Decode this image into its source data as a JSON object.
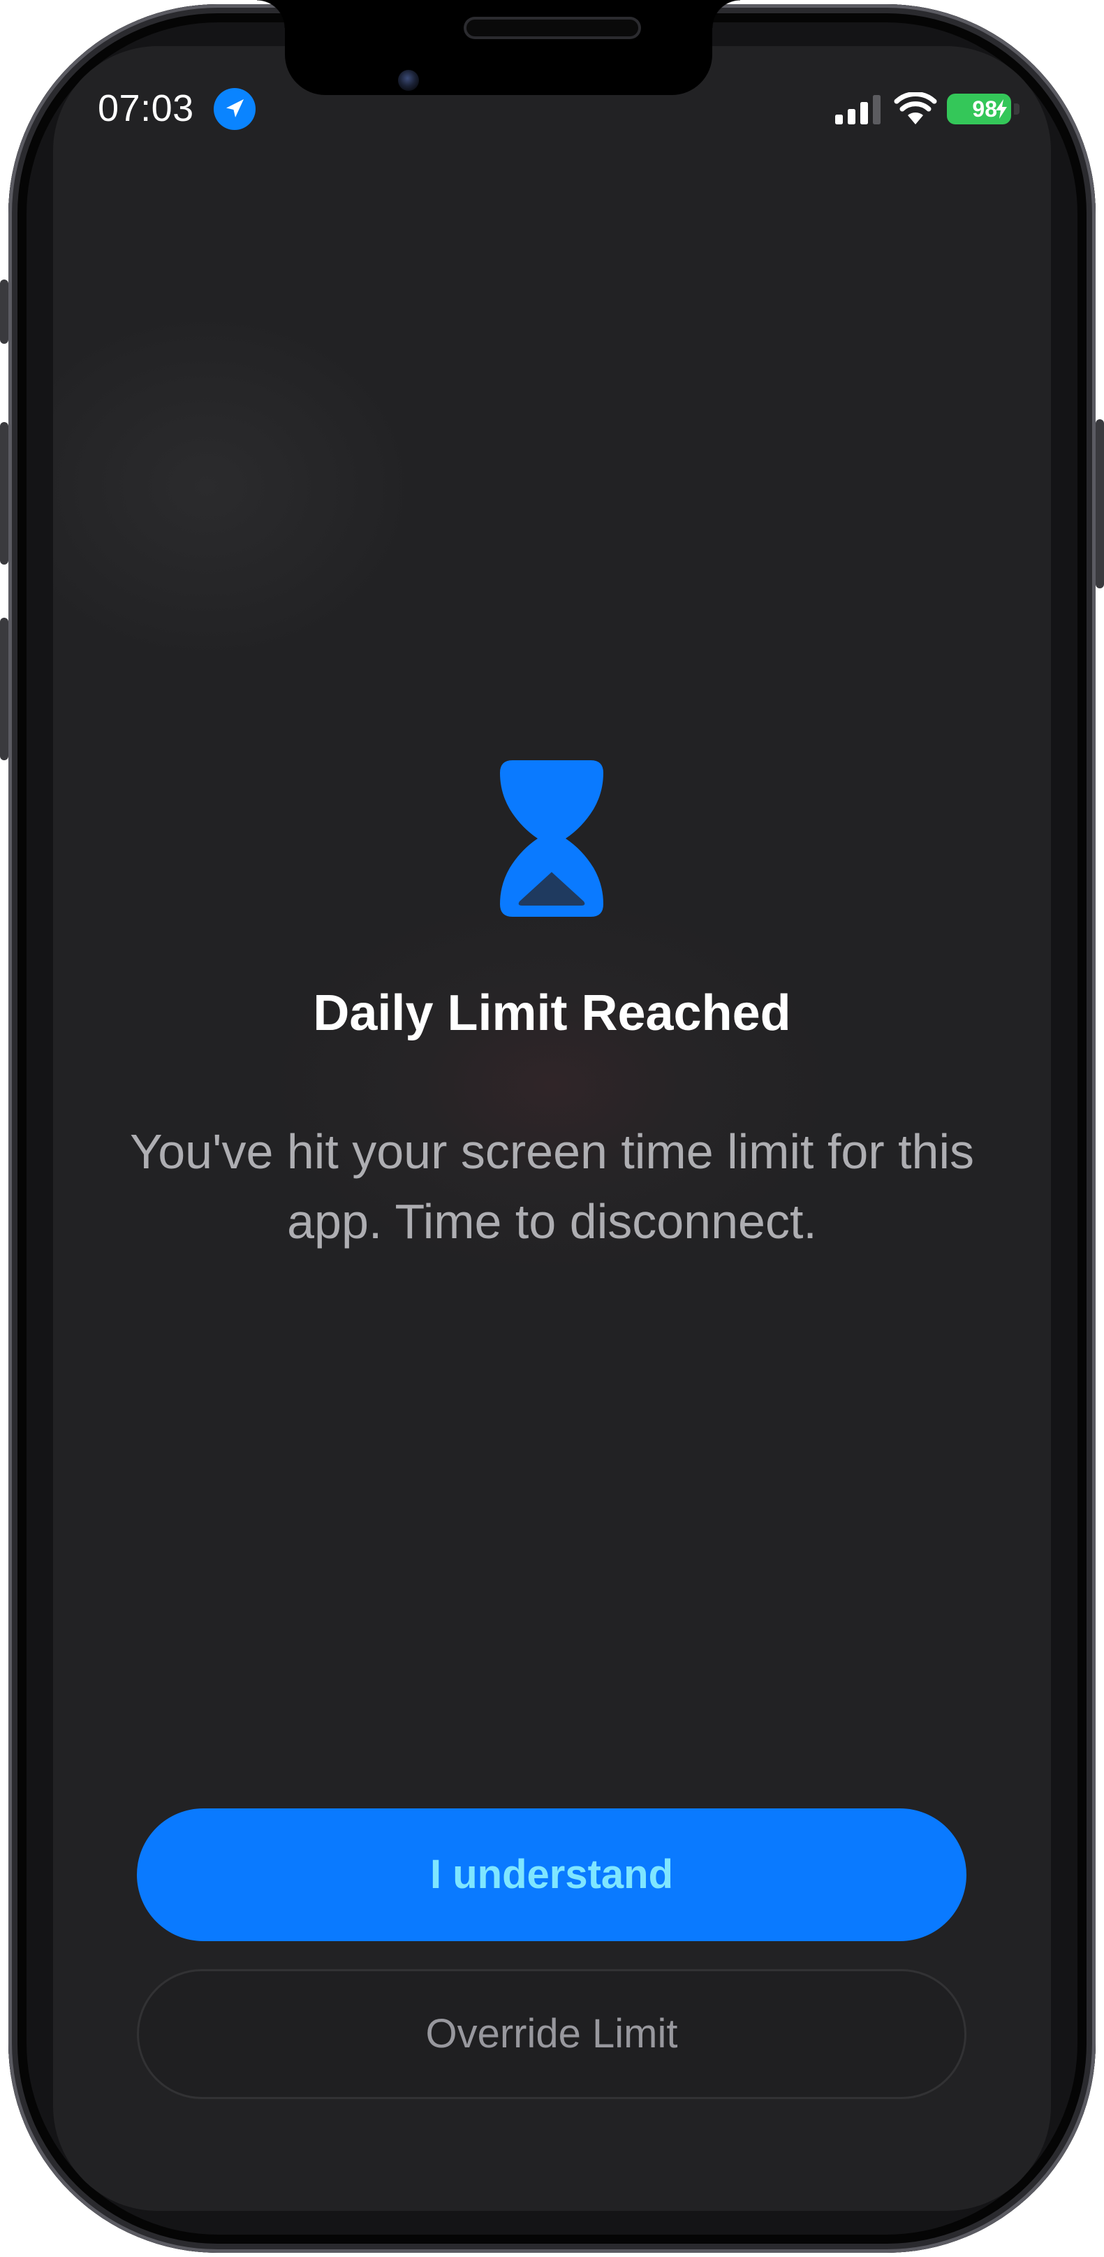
{
  "status_bar": {
    "time": "07:03",
    "battery_percent": "98",
    "icons": {
      "location": "location-arrow-icon",
      "signal": "cellular-signal-icon",
      "wifi": "wifi-icon",
      "charging": "charging-bolt-icon"
    }
  },
  "limit_screen": {
    "icon": "hourglass-icon",
    "title": "Daily Limit Reached",
    "message": "You've hit your screen time limit for this app. Time to disconnect.",
    "primary_button": "I understand",
    "secondary_button": "Override Limit"
  },
  "colors": {
    "accent": "#0a7aff",
    "primary_label": "#7fe6ff",
    "battery": "#34c759",
    "location_badge": "#0a84ff",
    "background": "#242426"
  }
}
